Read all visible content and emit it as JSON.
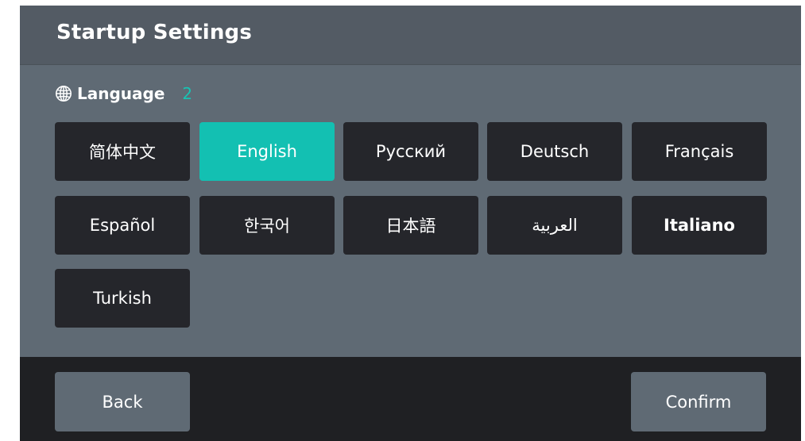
{
  "header": {
    "title": "Startup Settings"
  },
  "section": {
    "icon": "globe-icon",
    "label": "Language",
    "count": "2"
  },
  "languages": [
    {
      "label": "简体中文",
      "selected": false
    },
    {
      "label": "English",
      "selected": true
    },
    {
      "label": "Русский",
      "selected": false
    },
    {
      "label": "Deutsch",
      "selected": false
    },
    {
      "label": "Français",
      "selected": false
    },
    {
      "label": "Español",
      "selected": false
    },
    {
      "label": "한국어",
      "selected": false
    },
    {
      "label": "日本語",
      "selected": false
    },
    {
      "label": "العربية",
      "selected": false
    },
    {
      "label": "Italiano",
      "selected": false
    },
    {
      "label": "Turkish",
      "selected": false
    }
  ],
  "footer": {
    "back_label": "Back",
    "confirm_label": "Confirm"
  },
  "colors": {
    "accent": "#13c0b2",
    "button_dark": "#25262b",
    "panel": "#5f6a74",
    "header": "#535b64",
    "footer": "#1f2023"
  }
}
